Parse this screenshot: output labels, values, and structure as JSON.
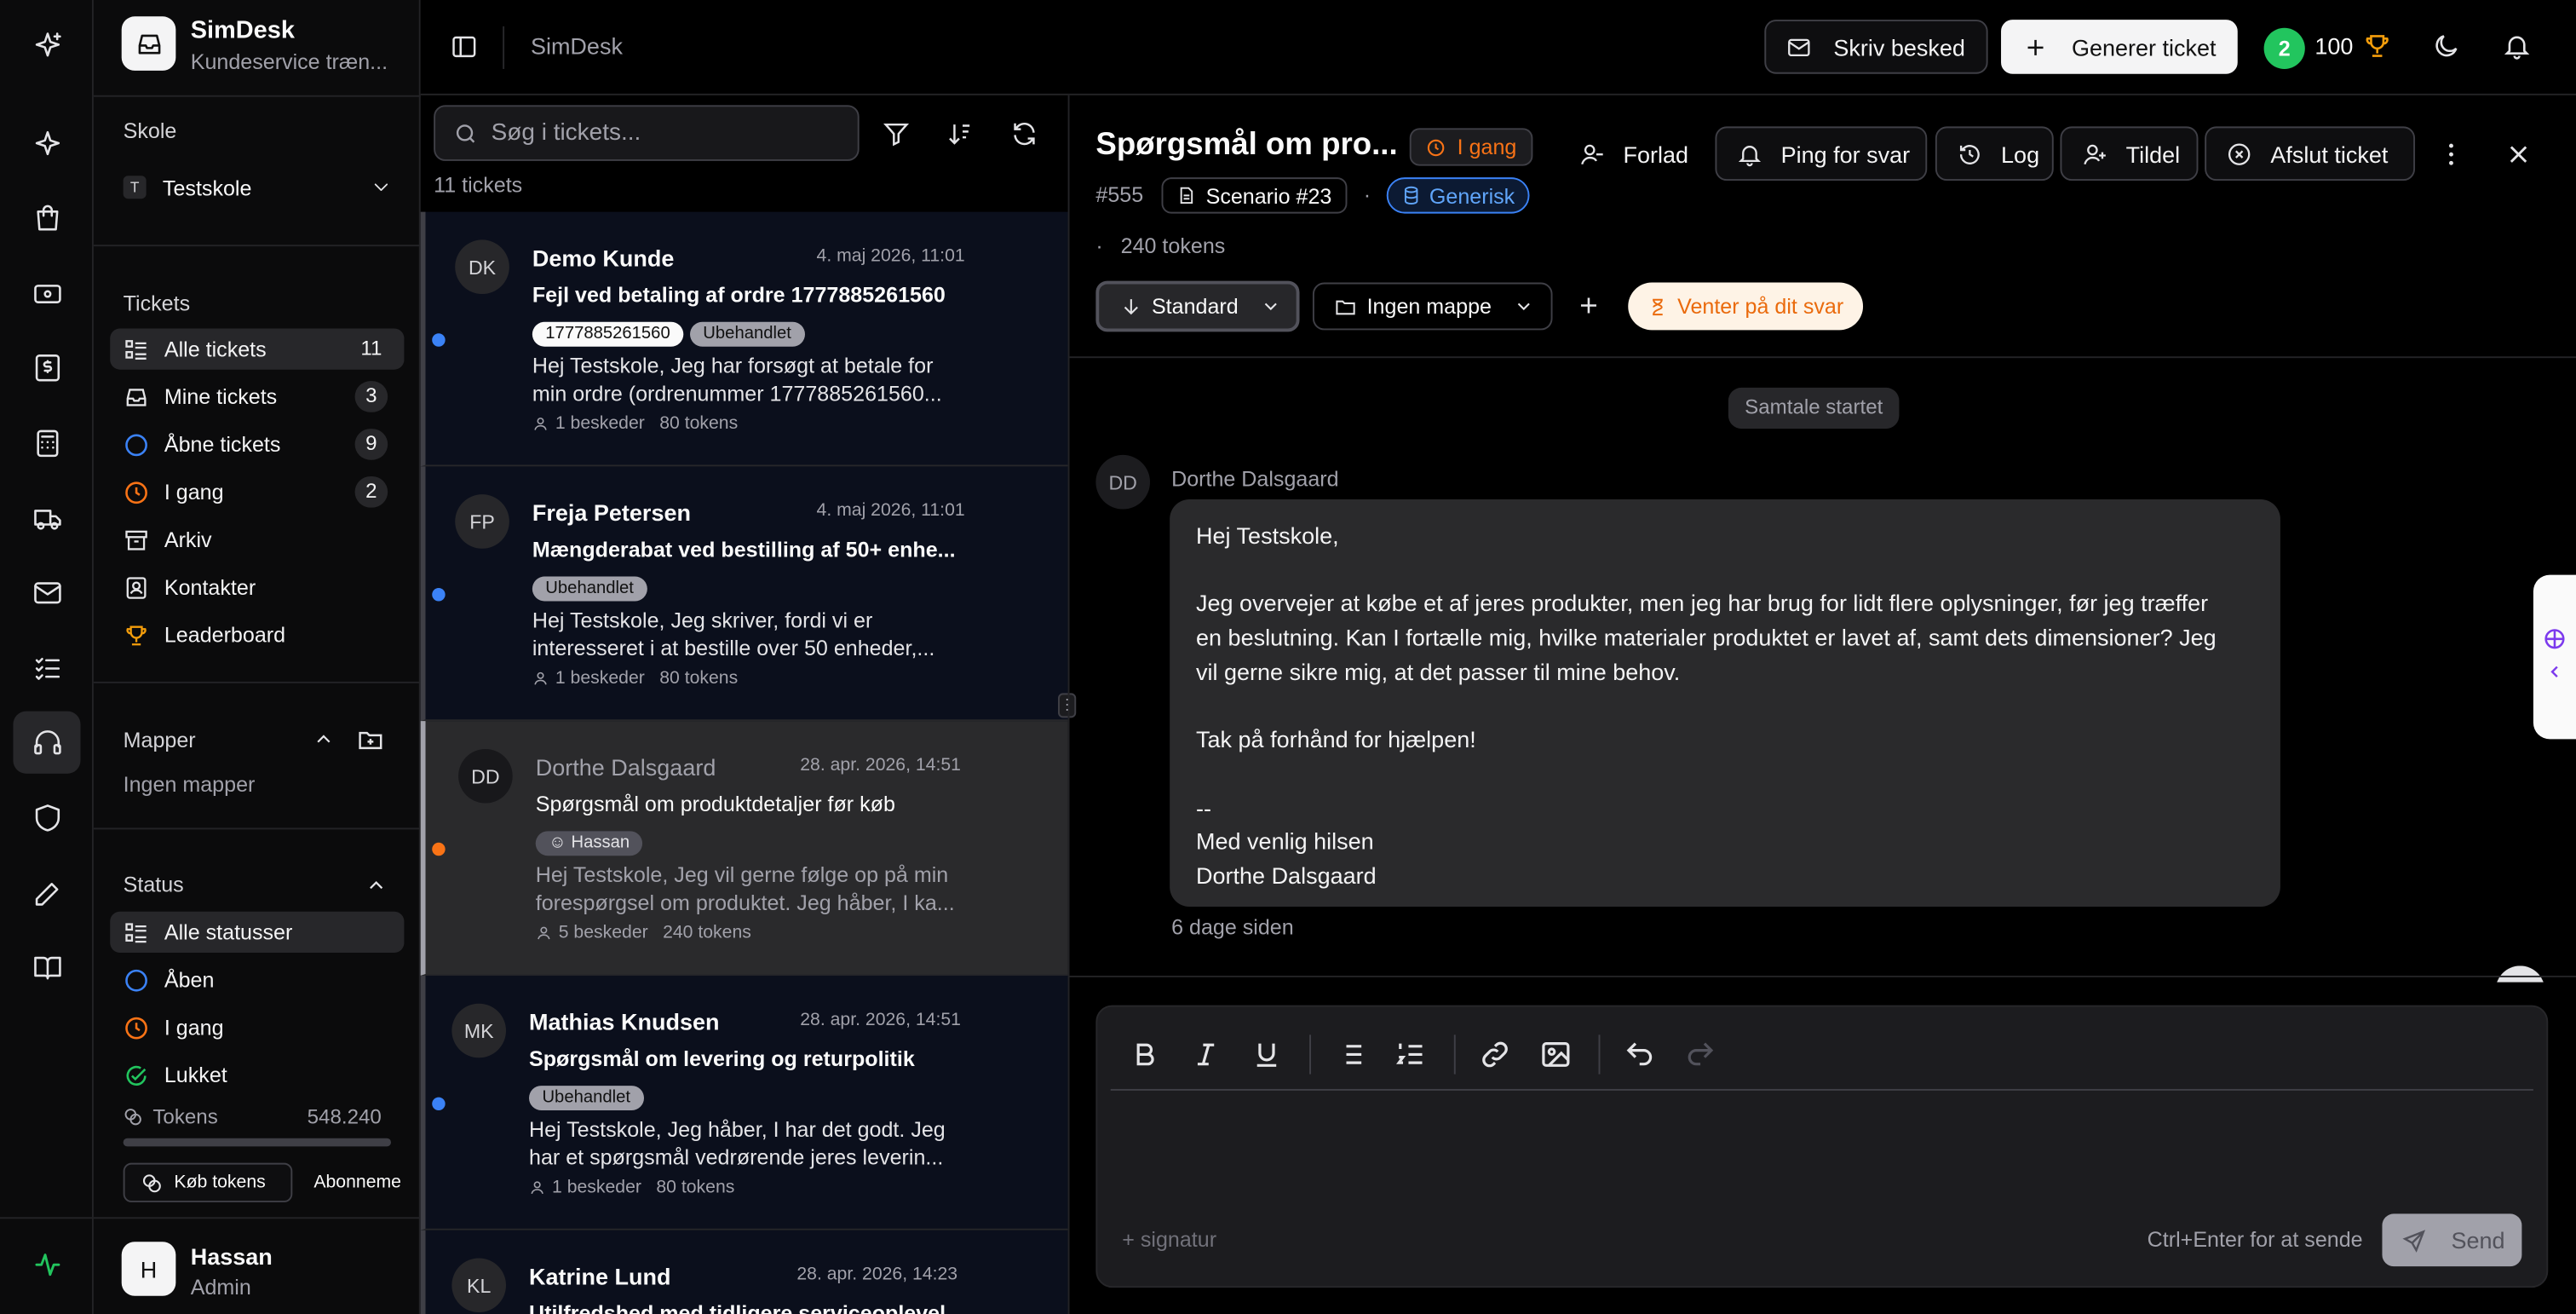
{
  "app": {
    "name": "SimDesk",
    "subtitle": "Kundeservice træn..."
  },
  "sidebar": {
    "school_label": "Skole",
    "school_badge": "T",
    "school_value": "Testskole",
    "tickets_label": "Tickets",
    "items": [
      {
        "label": "Alle tickets",
        "count": "11"
      },
      {
        "label": "Mine tickets",
        "count": "3"
      },
      {
        "label": "Åbne tickets",
        "count": "9"
      },
      {
        "label": "I gang",
        "count": "2"
      },
      {
        "label": "Arkiv"
      },
      {
        "label": "Kontakter"
      },
      {
        "label": "Leaderboard"
      }
    ],
    "folders_label": "Mapper",
    "folders_empty": "Ingen mapper",
    "status_label": "Status",
    "status_items": [
      {
        "label": "Alle statusser"
      },
      {
        "label": "Åben"
      },
      {
        "label": "I gang"
      },
      {
        "label": "Lukket"
      }
    ],
    "tokens_label": "Tokens",
    "tokens_value": "548.240",
    "buy_tokens": "Køb tokens",
    "subscription": "Abonneme",
    "user": {
      "initial": "H",
      "name": "Hassan",
      "role": "Admin"
    }
  },
  "header": {
    "breadcrumb": "SimDesk",
    "write_message": "Skriv besked",
    "generate_ticket": "Generer ticket",
    "level": "2",
    "points": "100"
  },
  "list": {
    "search_placeholder": "Søg i tickets...",
    "count": "11 tickets",
    "tickets": [
      {
        "initials": "DK",
        "name": "Demo Kunde",
        "date": "4. maj 2026, 11:01",
        "subject": "Fejl ved betaling af ordre 1777885261560",
        "tags": [
          "1777885261560",
          "Ubehandlet"
        ],
        "preview1": "Hej Testskole, Jeg har forsøgt at betale for",
        "preview2": "min ordre (ordrenummer 1777885261560...",
        "messages": "1 beskeder",
        "tokens": "80 tokens"
      },
      {
        "initials": "FP",
        "name": "Freja Petersen",
        "date": "4. maj 2026, 11:01",
        "subject": "Mængderabat ved bestilling af 50+ enhe...",
        "tags": [
          "Ubehandlet"
        ],
        "preview1": "Hej Testskole, Jeg skriver, fordi vi er",
        "preview2": "interesseret i at bestille over 50 enheder,...",
        "messages": "1 beskeder",
        "tokens": "80 tokens"
      },
      {
        "initials": "DD",
        "name": "Dorthe Dalsgaard",
        "date": "28. apr. 2026, 14:51",
        "subject": "Spørgsmål om produktdetaljer før køb",
        "tags": [
          "Hassan"
        ],
        "preview1": "Hej Testskole, Jeg vil gerne følge op på min",
        "preview2": "forespørgsel om produktet. Jeg håber, I ka...",
        "messages": "5 beskeder",
        "tokens": "240 tokens"
      },
      {
        "initials": "MK",
        "name": "Mathias Knudsen",
        "date": "28. apr. 2026, 14:51",
        "subject": "Spørgsmål om levering og returpolitik",
        "tags": [
          "Ubehandlet"
        ],
        "preview1": "Hej Testskole, Jeg håber, I har det godt. Jeg",
        "preview2": "har et spørgsmål vedrørende jeres leverin...",
        "messages": "1 beskeder",
        "tokens": "80 tokens"
      },
      {
        "initials": "KL",
        "name": "Katrine Lund",
        "date": "28. apr. 2026, 14:23",
        "subject": "Utilfredshed med tidligere serviceoplevel..."
      }
    ]
  },
  "detail": {
    "title": "Spørgsmål om pro...",
    "status": "I gang",
    "leave": "Forlad",
    "ping": "Ping for svar",
    "log": "Log",
    "assign": "Tildel",
    "close_ticket": "Afslut ticket",
    "id": "#555",
    "scenario": "Scenario #23",
    "generic": "Generisk",
    "tokens": "240 tokens",
    "standard": "Standard",
    "folder": "Ingen mappe",
    "waiting": "Venter på dit svar",
    "conversation_started": "Samtale startet",
    "sender_initials": "DD",
    "sender": "Dorthe Dalsgaard",
    "message": {
      "l1": "Hej Testskole,",
      "l2": "Jeg overvejer at købe et af jeres produkter, men jeg har brug for lidt flere oplysninger, før jeg træffer",
      "l3": "en beslutning. Kan I fortælle mig, hvilke materialer produktet er lavet af, samt dets dimensioner? Jeg",
      "l4": "vil gerne sikre mig, at det passer til mine behov.",
      "l5": "Tak på forhånd for hjælpen!",
      "l6": "--",
      "l7": "Med venlig hilsen",
      "l8": "Dorthe Dalsgaard"
    },
    "time_ago": "6 dage siden",
    "signature": "+ signatur",
    "shortcut": "Ctrl+Enter for at sende",
    "send": "Send"
  }
}
